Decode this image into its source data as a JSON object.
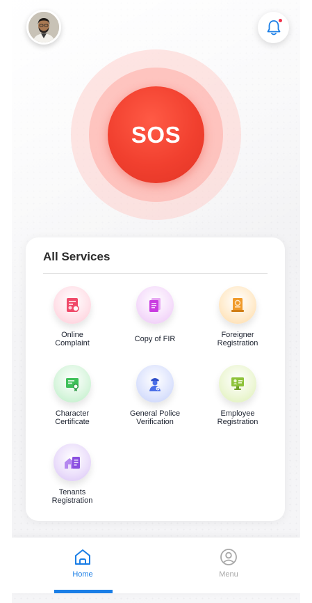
{
  "header": {
    "avatar_alt": "User profile photo",
    "notification_icon": "bell-icon",
    "has_unread": true
  },
  "sos": {
    "label": "SOS",
    "color": "#f1402f"
  },
  "services": {
    "title": "All Services",
    "items": [
      {
        "line1": "Online",
        "line2": "Complaint",
        "icon": "complaint-document-icon",
        "color": "#f04a6a"
      },
      {
        "line1": "Copy of FIR",
        "line2": "",
        "icon": "fir-document-icon",
        "color": "#c93be0"
      },
      {
        "line1": "Foreigner",
        "line2": "Registration",
        "icon": "passport-icon",
        "color": "#f09a2a"
      },
      {
        "line1": "Character",
        "line2": "Certificate",
        "icon": "certificate-icon",
        "color": "#3fc05a"
      },
      {
        "line1": "General Police",
        "line2": "Verification",
        "icon": "police-officer-icon",
        "color": "#4b6fe8"
      },
      {
        "line1": "Employee",
        "line2": "Registration",
        "icon": "employee-id-icon",
        "color": "#8dc23a"
      },
      {
        "line1": "Tenants",
        "line2": "Registration",
        "icon": "house-document-icon",
        "color": "#8a4fe0"
      }
    ]
  },
  "bottom_nav": {
    "items": [
      {
        "label": "Home",
        "icon": "home-icon",
        "active": true
      },
      {
        "label": "Menu",
        "icon": "user-circle-icon",
        "active": false
      }
    ],
    "active_color": "#1a7ee6",
    "inactive_color": "#a8a8a8"
  }
}
